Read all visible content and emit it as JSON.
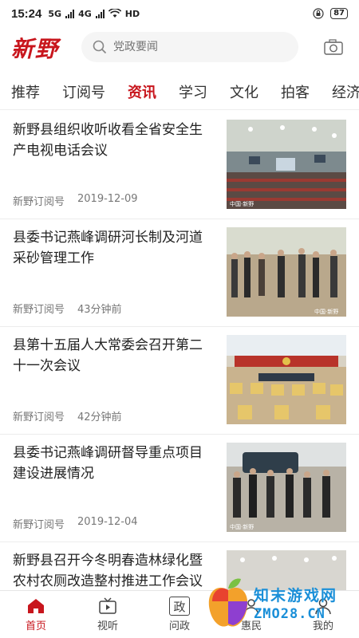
{
  "status": {
    "time": "15:24",
    "signal1": "5G",
    "signal2": "4G",
    "hd": "HD",
    "battery": "87"
  },
  "header": {
    "logo": "新野",
    "search_placeholder": "党政要闻",
    "icons": [
      "search-icon",
      "camera-icon"
    ]
  },
  "tabs": [
    "推荐",
    "订阅号",
    "资讯",
    "学习",
    "文化",
    "拍客",
    "经济"
  ],
  "active_tab": "资讯",
  "accent_color": "#c8161d",
  "articles": [
    {
      "title": "新野县组织收听收看全省安全生产电视电话会议",
      "source": "新野订阅号",
      "time": "2019-12-09",
      "image": "conference-hall-photo"
    },
    {
      "title": "县委书记燕峰调研河长制及河道采砂管理工作",
      "source": "新野订阅号",
      "time": "43分钟前",
      "image": "field-inspection-photo"
    },
    {
      "title": "县第十五届人大常委会召开第二十一次会议",
      "source": "新野订阅号",
      "time": "42分钟前",
      "image": "meeting-room-photo"
    },
    {
      "title": "县委书记燕峰调研督导重点项目建设进展情况",
      "source": "新野订阅号",
      "time": "2019-12-04",
      "image": "site-visit-photo"
    },
    {
      "title": "新野县召开今冬明春造林绿化暨农村农厕改造整村推进工作会议",
      "source": "",
      "time": "",
      "image": "hall-photo"
    }
  ],
  "thumb_watermark": "中国·新野",
  "tabbar": [
    {
      "label": "首页",
      "icon": "home-icon"
    },
    {
      "label": "视听",
      "icon": "tv-icon"
    },
    {
      "label": "问政",
      "icon": "zheng-box-icon",
      "glyph": "政"
    },
    {
      "label": "惠民",
      "icon": "people-icon"
    },
    {
      "label": "我的",
      "icon": "user-icon"
    }
  ],
  "watermark": {
    "text": "知末游戏网",
    "sub": "ZMO28.CN"
  }
}
